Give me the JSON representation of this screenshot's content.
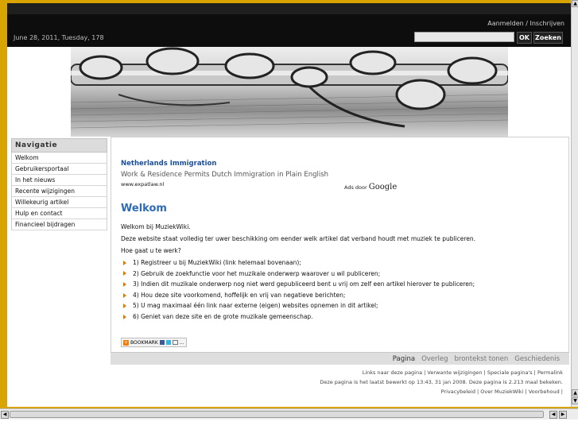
{
  "header": {
    "login_text": "Aanmelden / Inschrijven",
    "date_text": "June 28, 2011, Tuesday, 178",
    "search_placeholder": "",
    "ok_label": "OK",
    "search_label": "Zoeken"
  },
  "sidebar": {
    "title": "Navigatie",
    "items": [
      {
        "label": "Welkom"
      },
      {
        "label": "Gebruikersportaal"
      },
      {
        "label": "In het nieuws"
      },
      {
        "label": "Recente wijzigingen"
      },
      {
        "label": "Willekeurig artikel"
      },
      {
        "label": "Hulp en contact"
      },
      {
        "label": "Financieel bijdragen"
      }
    ]
  },
  "ad": {
    "title": "Netherlands Immigration",
    "text": "Work & Residence Permits Dutch Immigration in Plain English",
    "url": "www.expatlaw.nl",
    "ads_by": "Ads door",
    "ads_brand": "Google"
  },
  "main": {
    "heading": "Welkom",
    "welcome": "Welkom bij MuziekWiki.",
    "intro": "Deze website staat volledig ter uwer beschikking om eender welk artikel dat verband houdt met muziek te publiceren.",
    "how": "Hoe gaat u te werk?",
    "steps": [
      "1) Registreer u bij MuziekWiki (link helemaal bovenaan);",
      "2) Gebruik de zoekfunctie voor het muzikale onderwerp waarover u wil publiceren;",
      "3) Indien dit muzikale onderwerp nog niet werd gepubliceerd bent u vrij om zelf een artikel hierover te publiceren;",
      "4) Hou deze site voorkomend, hoffelijk en vrij van negatieve berichten;",
      "5) U mag maximaal één link naar externe (eigen) websites opnemen in dit artikel;",
      "6) Geniet van deze site en de grote muzikale gemeenschap."
    ],
    "bookmark_label": "BOOKMARK"
  },
  "tabs": [
    "Pagina",
    "Overleg",
    "brontekst tonen",
    "Geschiedenis"
  ],
  "footer": {
    "line1": "Links naar deze pagina | Verwante wijzigingen | Speciale pagina's | Permalink",
    "line2": "Deze pagina is het laatst bewerkt op 13:43, 31 jan 2008. Deze pagina is 2.213 maal bekeken.",
    "line3": "Privacybeleid | Over MuziekWiki | Voorbehoud |"
  },
  "colors": {
    "frame": "#d9a300",
    "link": "#1a4f9c",
    "heading": "#2e6bb7",
    "bullet": "#e07b00"
  }
}
